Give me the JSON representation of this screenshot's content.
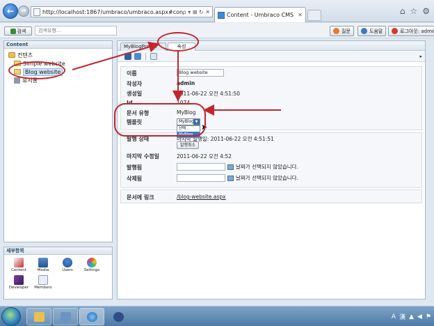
{
  "browser": {
    "url": "http://localhost:1867/umbraco/umbraco.aspx#content",
    "tab_title": "Content - Umbraco CMS -...",
    "address_tools": "ρ ▾ ⊠ ↻ ✕"
  },
  "header": {
    "search_button": "검색",
    "search_placeholder": "검색유형...",
    "feedback_button": "질문",
    "help_button": "도움말",
    "logout_button": "로그아웃: admin"
  },
  "content_tree": {
    "title": "Content",
    "root": "컨텐츠",
    "items": [
      "Simple website",
      "Blog website",
      "휴지통"
    ]
  },
  "sections": {
    "title": "세부항목",
    "items": [
      "Content",
      "Media",
      "Users",
      "Settings",
      "Developer",
      "Members"
    ]
  },
  "editor": {
    "tabs": [
      "MyBlogProp...",
      "속성"
    ],
    "properties": {
      "name_label": "이름",
      "name_value": "Blog website",
      "author_label": "작성자",
      "author_value": "admin",
      "created_label": "생성일",
      "created_value": "2011-06-22 오전 4:51:50",
      "id_label": "Id",
      "id_value": "1074",
      "doctype_label": "문서 유형",
      "doctype_value": "MyBlog",
      "template_label": "템플릿",
      "template_selected": "MyBlog",
      "template_options": [
        "선택...",
        "MyBlog"
      ]
    },
    "publish": {
      "status_label": "발행 상태",
      "status_value": "마지막 발행일: 2011-06-22 오전 4:51:51",
      "unpublish_button": "발행취소",
      "modified_label": "마지막 수정일",
      "modified_value": "2011-06-22 오전 4:52",
      "publish_at_label": "발행됨",
      "publish_at_note": "날짜가 선택되지 않았습니다.",
      "remove_at_label": "삭제됨",
      "remove_at_note": "날짜가 선택되지 않았습니다."
    },
    "link_label": "문서에 링크",
    "link_value": "/blog-website.aspx"
  },
  "colors": {
    "annotation": "#c2262c",
    "selection": "#cfe3f8"
  }
}
